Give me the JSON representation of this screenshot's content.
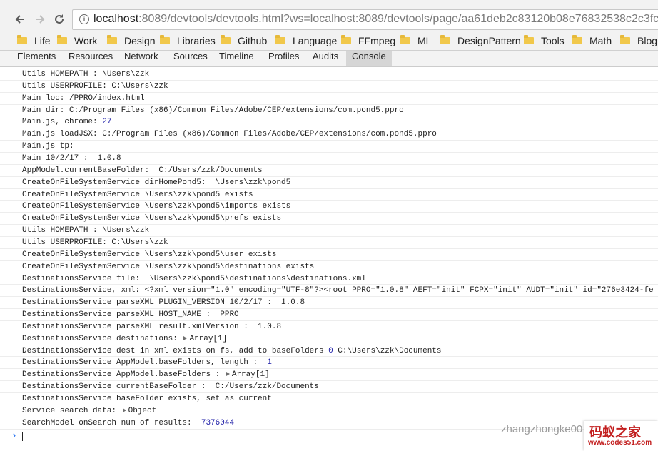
{
  "toolbar": {
    "url_host": "localhost",
    "url_rest": ":8089/devtools/devtools.html?ws=localhost:8089/devtools/page/aa61deb2c83120b08e76832538c2c3fc"
  },
  "bookmarks": [
    {
      "label": "Life"
    },
    {
      "label": "Work"
    },
    {
      "label": "Design"
    },
    {
      "label": "Libraries"
    },
    {
      "label": "Github"
    },
    {
      "label": "Language"
    },
    {
      "label": "FFmpeg"
    },
    {
      "label": "ML"
    },
    {
      "label": "DesignPattern"
    },
    {
      "label": "Tools"
    },
    {
      "label": "Math"
    },
    {
      "label": "Blog"
    }
  ],
  "devtools": {
    "tabs": [
      {
        "label": "Elements"
      },
      {
        "label": "Resources"
      },
      {
        "label": "Network"
      },
      {
        "label": "Sources"
      },
      {
        "label": "Timeline"
      },
      {
        "label": "Profiles"
      },
      {
        "label": "Audits"
      },
      {
        "label": "Console",
        "active": true
      }
    ]
  },
  "console": {
    "lines": [
      {
        "text": "Utils HOMEPATH : \\Users\\zzk"
      },
      {
        "text": "Utils USERPROFILE: C:\\Users\\zzk"
      },
      {
        "text": "Main loc: /PPRO/index.html"
      },
      {
        "text": "Main dir: C:/Program Files (x86)/Common Files/Adobe/CEP/extensions/com.pond5.ppro"
      },
      {
        "text": "Main.js, chrome: ",
        "num": "27"
      },
      {
        "text": "Main.js loadJSX: C:/Program Files (x86)/Common Files/Adobe/CEP/extensions/com.pond5.ppro"
      },
      {
        "text": "Main.js tp:"
      },
      {
        "text": "Main 10/2/17 :  1.0.8"
      },
      {
        "text": "AppModel.currentBaseFolder:  C:/Users/zzk/Documents"
      },
      {
        "text": "CreateOnFileSystemService dirHomePond5:  \\Users\\zzk\\pond5"
      },
      {
        "text": "CreateOnFileSystemService \\Users\\zzk\\pond5 exists"
      },
      {
        "text": "CreateOnFileSystemService \\Users\\zzk\\pond5\\imports exists"
      },
      {
        "text": "CreateOnFileSystemService \\Users\\zzk\\pond5\\prefs exists"
      },
      {
        "text": "Utils HOMEPATH : \\Users\\zzk"
      },
      {
        "text": "Utils USERPROFILE: C:\\Users\\zzk"
      },
      {
        "text": "CreateOnFileSystemService \\Users\\zzk\\pond5\\user exists"
      },
      {
        "text": "CreateOnFileSystemService \\Users\\zzk\\pond5\\destinations exists"
      },
      {
        "text": "DestinationsService file:  \\Users\\zzk\\pond5\\destinations\\destinations.xml"
      },
      {
        "text": "DestinationsService, xml: <?xml version=\"1.0\" encoding=\"UTF-8\"?><root PPRO=\"1.0.8\" AEFT=\"init\" FCPX=\"init\" AUDT=\"init\" id=\"276e3424-fe"
      },
      {
        "text": "DestinationsService parseXML PLUGIN_VERSION 10/2/17 :  1.0.8"
      },
      {
        "text": "DestinationsService parseXML HOST_NAME :  PPRO"
      },
      {
        "text": "DestinationsService parseXML result.xmlVersion :  1.0.8"
      },
      {
        "text": "DestinationsService destinations: ",
        "expand": "Array[1]"
      },
      {
        "text": "DestinationsService dest in xml exists on fs, add to baseFolders ",
        "num": "0",
        "after": " C:\\Users\\zzk\\Documents"
      },
      {
        "text": "DestinationsService AppModel.baseFolders, length :  ",
        "num": "1"
      },
      {
        "text": "DestinationsService AppModel.baseFolders : ",
        "expand": "Array[1]"
      },
      {
        "text": "DestinationsService currentBaseFolder :  C:/Users/zzk/Documents"
      },
      {
        "text": "DestinationsService baseFolder exists, set as current"
      },
      {
        "text": "Service search data: ",
        "expand": "Object"
      },
      {
        "text": "SearchModel onSearch num of results:  ",
        "num": "7376044"
      }
    ],
    "prompt_symbol": "›"
  },
  "overlay": {
    "watermark": "zhangzhongke00",
    "logo_title": "码蚁之家",
    "logo_url": "www.codes51.com"
  },
  "colors": {
    "number": "#1a1aa6",
    "prompt": "#367cf1",
    "folder": "#f1c84b",
    "logo": "#c21e1e"
  }
}
